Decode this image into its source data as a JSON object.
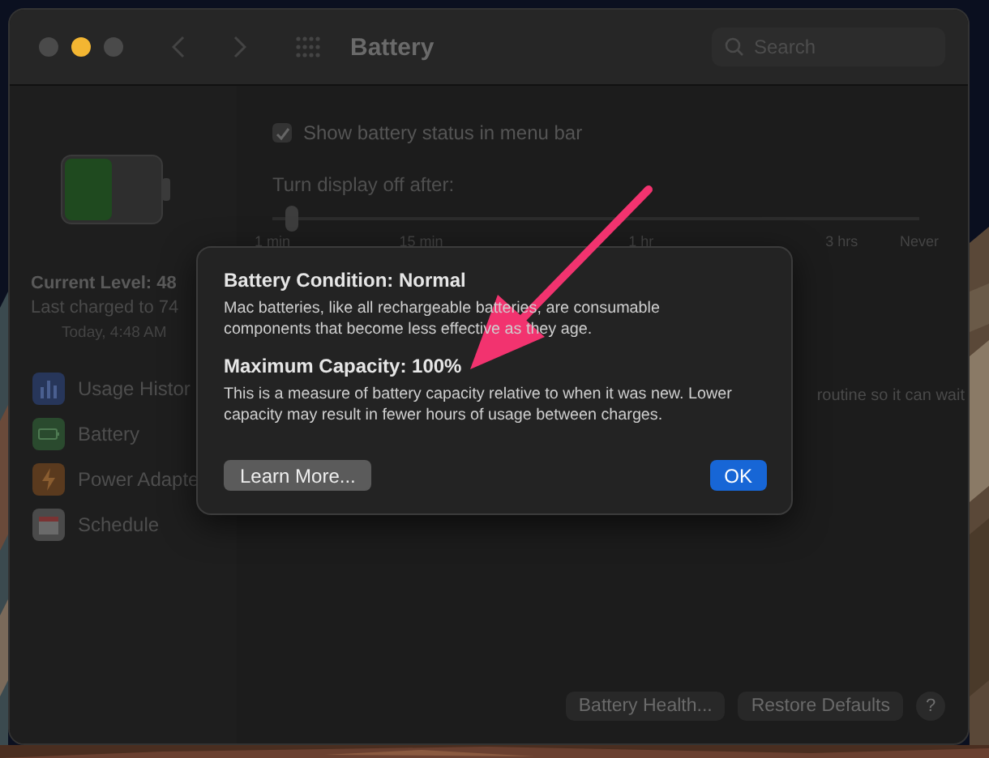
{
  "window": {
    "title": "Battery",
    "search": {
      "placeholder": "Search"
    }
  },
  "sidebar": {
    "current_level": "Current Level: 48",
    "last_charged": "Last charged to 74",
    "time": "Today, 4:48 AM",
    "items": [
      {
        "label": "Usage Histor",
        "kind": "usage",
        "selected": false
      },
      {
        "label": "Battery",
        "kind": "battery",
        "selected": false
      },
      {
        "label": "Power Adapte",
        "kind": "adapter",
        "selected": false
      },
      {
        "label": "Schedule",
        "kind": "schedule",
        "selected": false
      }
    ]
  },
  "main": {
    "show_status": {
      "label": "Show battery status in menu bar",
      "checked": true
    },
    "display_off": {
      "label": "Turn display off after:",
      "level": 0.03,
      "ticks": [
        "1 min",
        "15 min",
        "1 hr",
        "3 hrs",
        "Never"
      ]
    },
    "note": "routine so it can wait",
    "buttons": [
      "Battery Health...",
      "Restore Defaults"
    ],
    "help": "?"
  },
  "dialog": {
    "condition": "Battery Condition: Normal",
    "condition_text": "Mac batteries, like all rechargeable batteries, are consumable components that become less effective as they age.",
    "capacity": "Maximum Capacity: 100%",
    "capacity_text": "This is a measure of battery capacity relative to when it was new. Lower capacity may result in fewer hours of usage between charges.",
    "buttons": [
      {
        "label": "Learn More...",
        "kind": "secondary"
      },
      {
        "label": "OK",
        "kind": "default"
      }
    ]
  }
}
